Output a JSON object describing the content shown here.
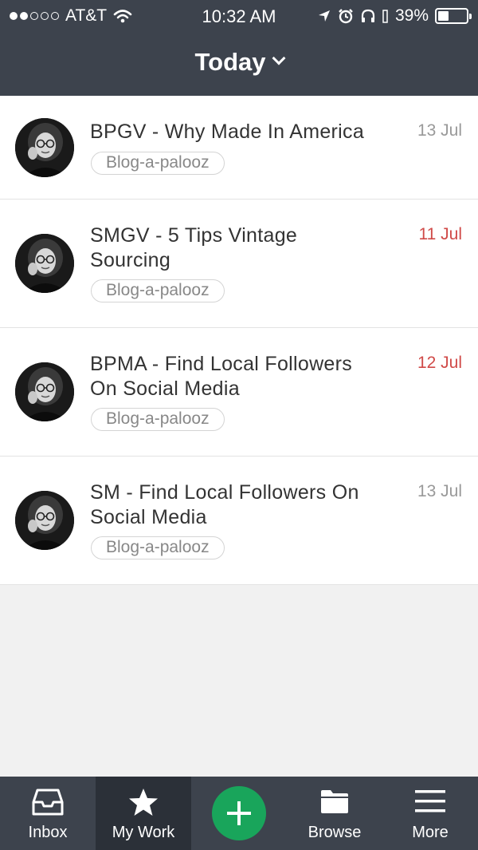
{
  "status": {
    "carrier": "AT&T",
    "signal_bars_filled": 2,
    "signal_bars_total": 5,
    "time": "10:32 AM",
    "battery": "39%",
    "battery_level": 0.39,
    "icons": [
      "wifi-icon",
      "location-arrow-icon",
      "alarm-icon",
      "headphones-icon",
      "battery-icon"
    ]
  },
  "header": {
    "title": "Today",
    "icon": "chevron-down-icon"
  },
  "tasks": [
    {
      "title_lines": [
        "BPGV - Why Made In America"
      ],
      "date": "13 Jul",
      "overdue": false,
      "tag": "Blog-a-palooz"
    },
    {
      "title_lines": [
        "SMGV - 5 Tips Vintage",
        "Sourcing"
      ],
      "date": "11 Jul",
      "overdue": true,
      "tag": "Blog-a-palooz"
    },
    {
      "title_lines": [
        "BPMA - Find Local Followers",
        "On Social Media"
      ],
      "date": "12 Jul",
      "overdue": true,
      "tag": "Blog-a-palooz"
    },
    {
      "title_lines": [
        "SM - Find Local Followers On",
        "Social Media"
      ],
      "date": "13 Jul",
      "overdue": false,
      "tag": "Blog-a-palooz"
    }
  ],
  "tabbar": {
    "inbox": {
      "label": "Inbox",
      "icon": "inbox-icon"
    },
    "my_work": {
      "label": "My Work",
      "icon": "star-icon",
      "active": true
    },
    "add": {
      "icon": "plus-icon"
    },
    "browse": {
      "label": "Browse",
      "icon": "folder-icon"
    },
    "more": {
      "label": "More",
      "icon": "hamburger-menu-icon"
    }
  },
  "colors": {
    "header_bg": "#3d434d",
    "active_tab_bg": "#2b3038",
    "accent_green": "#19a55b",
    "overdue_red": "#d04a48",
    "date_gray": "#999999"
  }
}
